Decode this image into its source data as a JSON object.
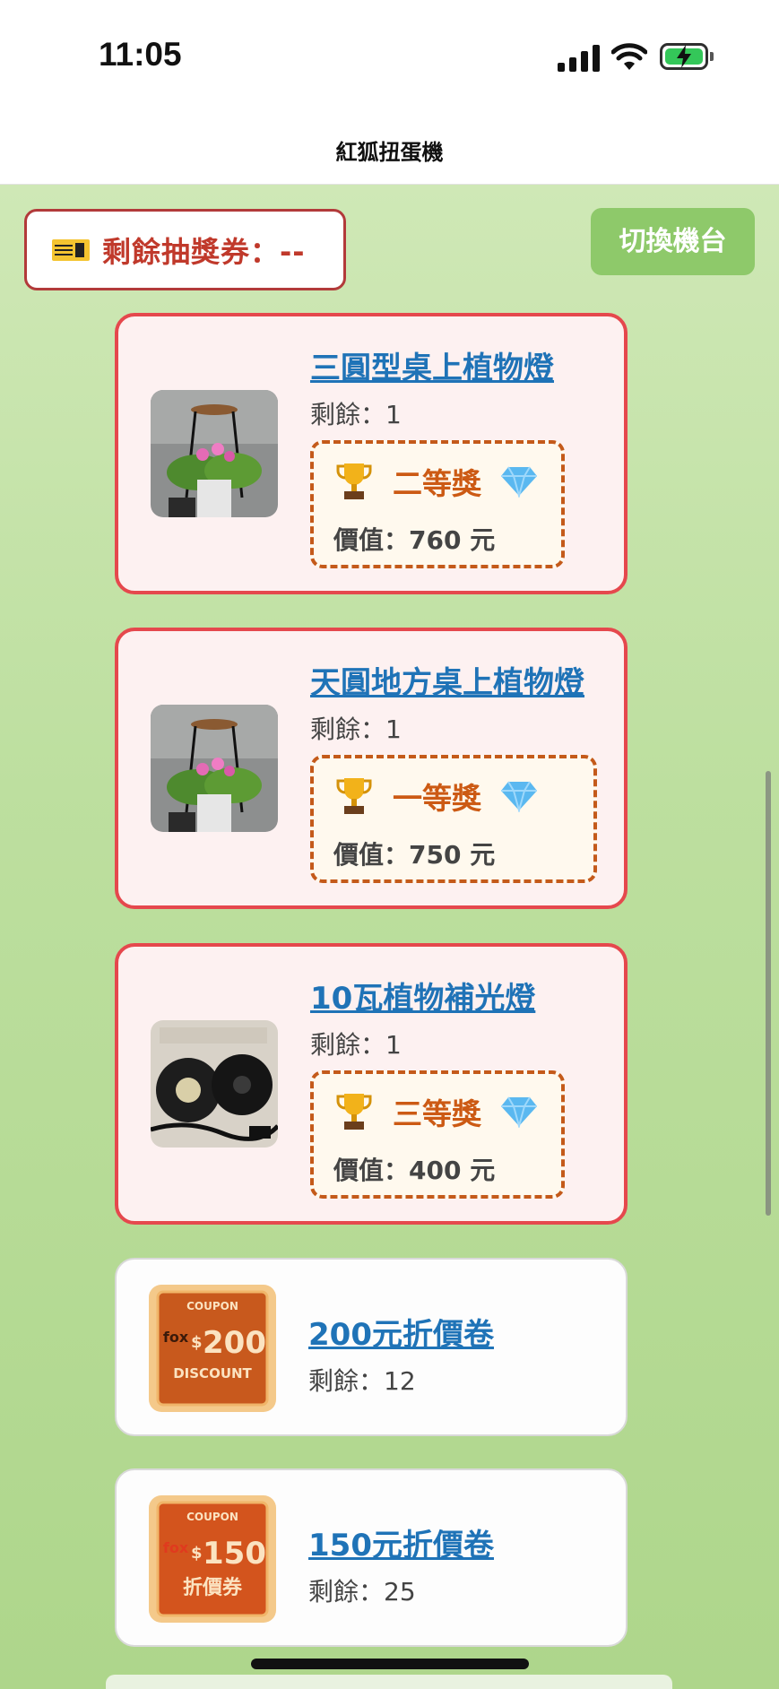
{
  "status_bar": {
    "time": "11:05"
  },
  "nav": {
    "title": "紅狐扭蛋機"
  },
  "ticket": {
    "label": "剩餘抽獎券：--"
  },
  "switch_button": {
    "label": "切換機台"
  },
  "prizes": [
    {
      "name": "三圓型桌上植物燈",
      "remaining": "剩餘：1",
      "rank": "二等獎",
      "value": "價值：760 元"
    },
    {
      "name": "天圓地方桌上植物燈",
      "remaining": "剩餘：1",
      "rank": "一等獎",
      "value": "價值：750 元"
    },
    {
      "name": "10瓦植物補光燈",
      "remaining": "剩餘：1",
      "rank": "三等獎",
      "value": "價值：400 元"
    }
  ],
  "coupons": [
    {
      "name": "200元折價卷",
      "remaining": "剩餘：12",
      "img_top": "COUPON",
      "img_amount": "200",
      "img_bottom": "DISCOUNT",
      "img_brand": "fox"
    },
    {
      "name": "150元折價卷",
      "remaining": "剩餘：25",
      "img_top": "COUPON",
      "img_amount": "150",
      "img_bottom": "折價券",
      "img_brand": "fox"
    }
  ],
  "icons": {
    "trophy": "trophy-icon",
    "gem": "gem-icon",
    "ticket": "ticket-icon"
  },
  "colors": {
    "prize_border": "#e5484d",
    "link": "#1f73b7",
    "rank": "#cc5a14",
    "switch_button": "#8ec96a",
    "ticket_text": "#c0392b"
  }
}
